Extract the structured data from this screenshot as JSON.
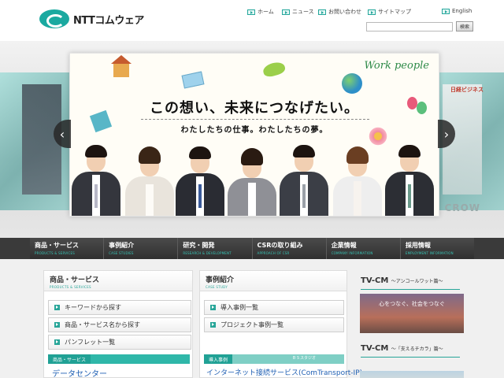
{
  "header": {
    "logo_text": "NTTコムウェア",
    "nav": {
      "home": "ホーム",
      "news": "ニュース",
      "contact": "お問い合わせ",
      "sitemap": "サイトマップ",
      "english": "English"
    },
    "search": {
      "placeholder": "",
      "button_label": "検索"
    }
  },
  "hero": {
    "title": "この想い、未来につなげたい。",
    "subtitle": "わたしたちの仕事。わたしたちの夢。",
    "brand": "Work people",
    "side_right_label": "日経ビジネス",
    "side_right_bottom": "CROW",
    "arrow_left": "‹",
    "arrow_right": "›"
  },
  "main_nav": [
    {
      "label": "商品・サービス",
      "sub": "PRODUCTS & SERVICES"
    },
    {
      "label": "事例紹介",
      "sub": "CASE STUDIES"
    },
    {
      "label": "研究・開発",
      "sub": "RESEARCH & DEVELOPMENT"
    },
    {
      "label": "CSRの取り組み",
      "sub": "APPROACH OF CSR"
    },
    {
      "label": "企業情報",
      "sub": "COMPANY INFORMATION"
    },
    {
      "label": "採用情報",
      "sub": "EMPLOYMENT INFORMATION"
    }
  ],
  "products": {
    "title": "商品・サービス",
    "sub": "PRODUCTS & SERVICES",
    "links": [
      "キーワードから探す",
      "商品・サービス名から探す",
      "パンフレット一覧"
    ],
    "feature_tab": "商品・サービス",
    "feature_title": "データセンター"
  },
  "cases": {
    "title": "事例紹介",
    "sub": "CASE STUDY",
    "links": [
      "導入事例一覧",
      "プロジェクト事例一覧"
    ],
    "feature_tab": "導入事例",
    "feature_note": "ＢＳスタジオ",
    "feature_title": "インターネット接続サービス(ComTransport-IP)"
  },
  "tvcm": {
    "item1_title": "TV-CM",
    "item1_sub": "～アンコールワット篇～",
    "item1_caption": "心をつなぐ、社会をつなぐ",
    "item2_title": "TV-CM",
    "item2_sub": "～「支えるチカラ」篇～"
  },
  "colors": {
    "accent": "#27a598",
    "nav_bg": "#3a3a3a",
    "link_blue": "#1f5fb3"
  }
}
